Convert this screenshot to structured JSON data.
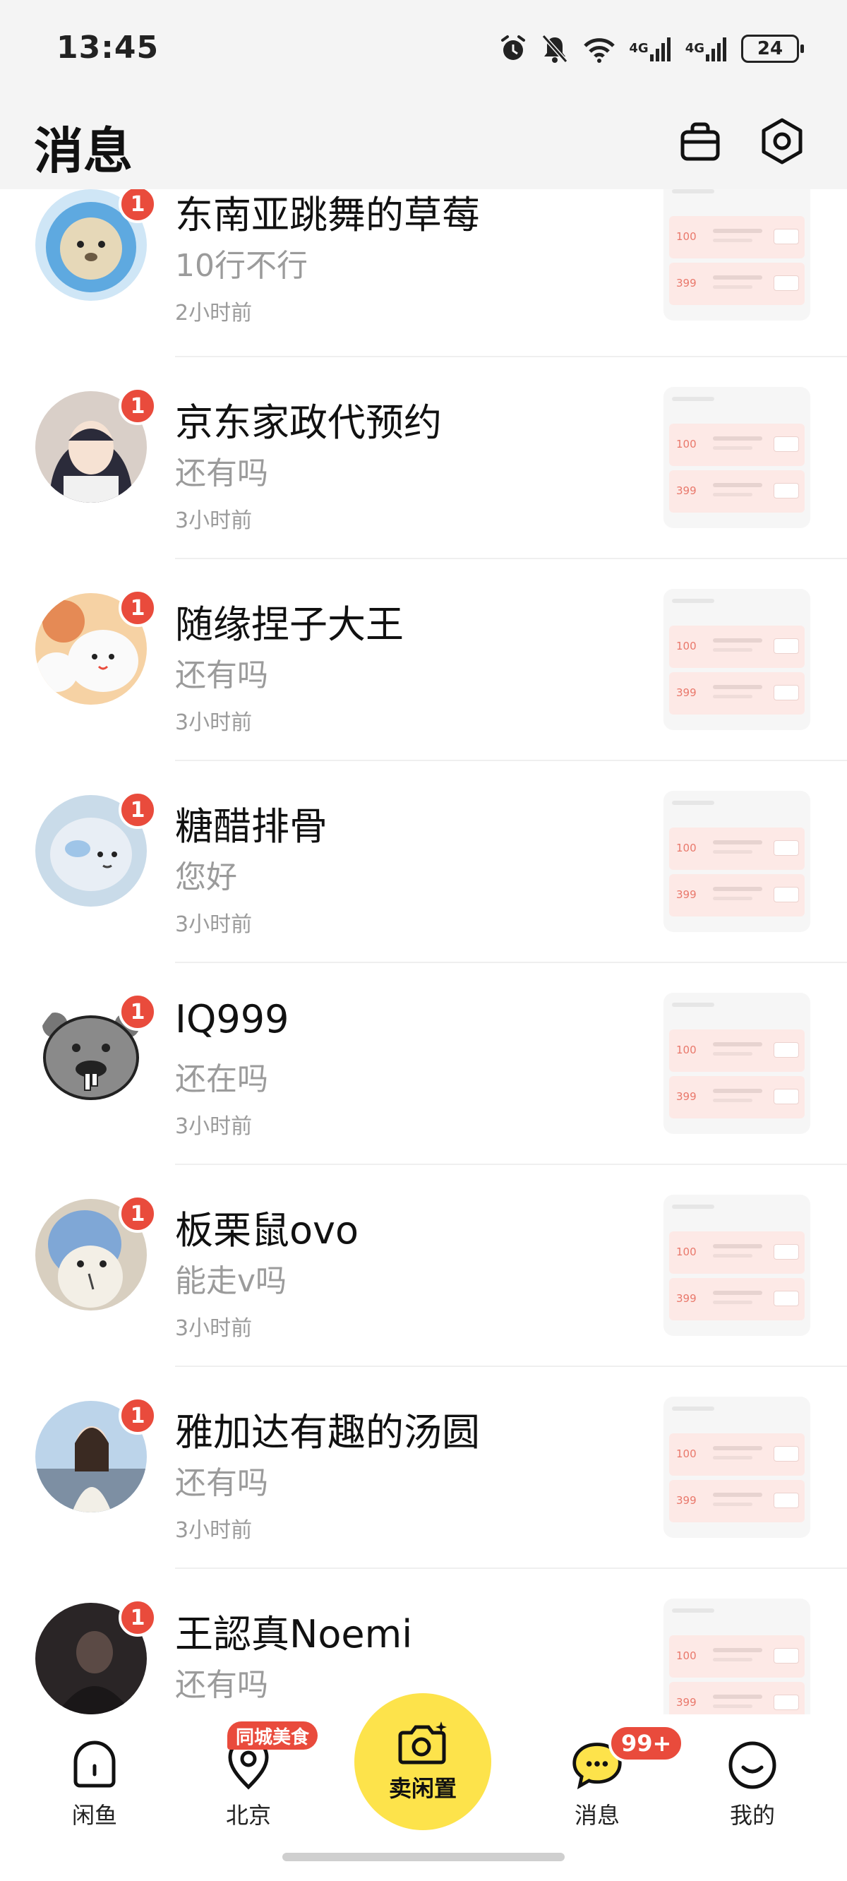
{
  "status_bar": {
    "time": "13:45",
    "signal_label_1": "4G",
    "signal_label_2": "4G",
    "battery": "24"
  },
  "header": {
    "title": "消息"
  },
  "conversations": [
    {
      "name": "东南亚跳舞的草莓",
      "preview": "10行不行",
      "time": "2小时前",
      "unread": "1",
      "avatar_color": "#5ea9e0"
    },
    {
      "name": "京东家政代预约",
      "preview": "还有吗",
      "time": "3小时前",
      "unread": "1",
      "avatar_color": "#2b2b3a"
    },
    {
      "name": "随缘捏子大王",
      "preview": "还有吗",
      "time": "3小时前",
      "unread": "1",
      "avatar_color": "#f2b56a"
    },
    {
      "name": "糖醋排骨",
      "preview": "您好",
      "time": "3小时前",
      "unread": "1",
      "avatar_color": "#9fc5e8"
    },
    {
      "name": "IQ999",
      "preview": "还在吗",
      "time": "3小时前",
      "unread": "1",
      "avatar_color": "#8a8a8a"
    },
    {
      "name": "板栗鼠ovo",
      "preview": "能走v吗",
      "time": "3小时前",
      "unread": "1",
      "avatar_color": "#7fa7d6"
    },
    {
      "name": "雅加达有趣的汤圆",
      "preview": "还有吗",
      "time": "3小时前",
      "unread": "1",
      "avatar_color": "#bcd4ea"
    },
    {
      "name": "王認真Noemi",
      "preview": "还有吗",
      "time": "",
      "unread": "1",
      "avatar_color": "#2a2526"
    }
  ],
  "thumb": {
    "price1": "100",
    "price2": "399"
  },
  "nav": {
    "home": "闲鱼",
    "city": "北京",
    "city_tag": "同城美食",
    "sell": "卖闲置",
    "messages": "消息",
    "messages_badge": "99+",
    "me": "我的"
  }
}
